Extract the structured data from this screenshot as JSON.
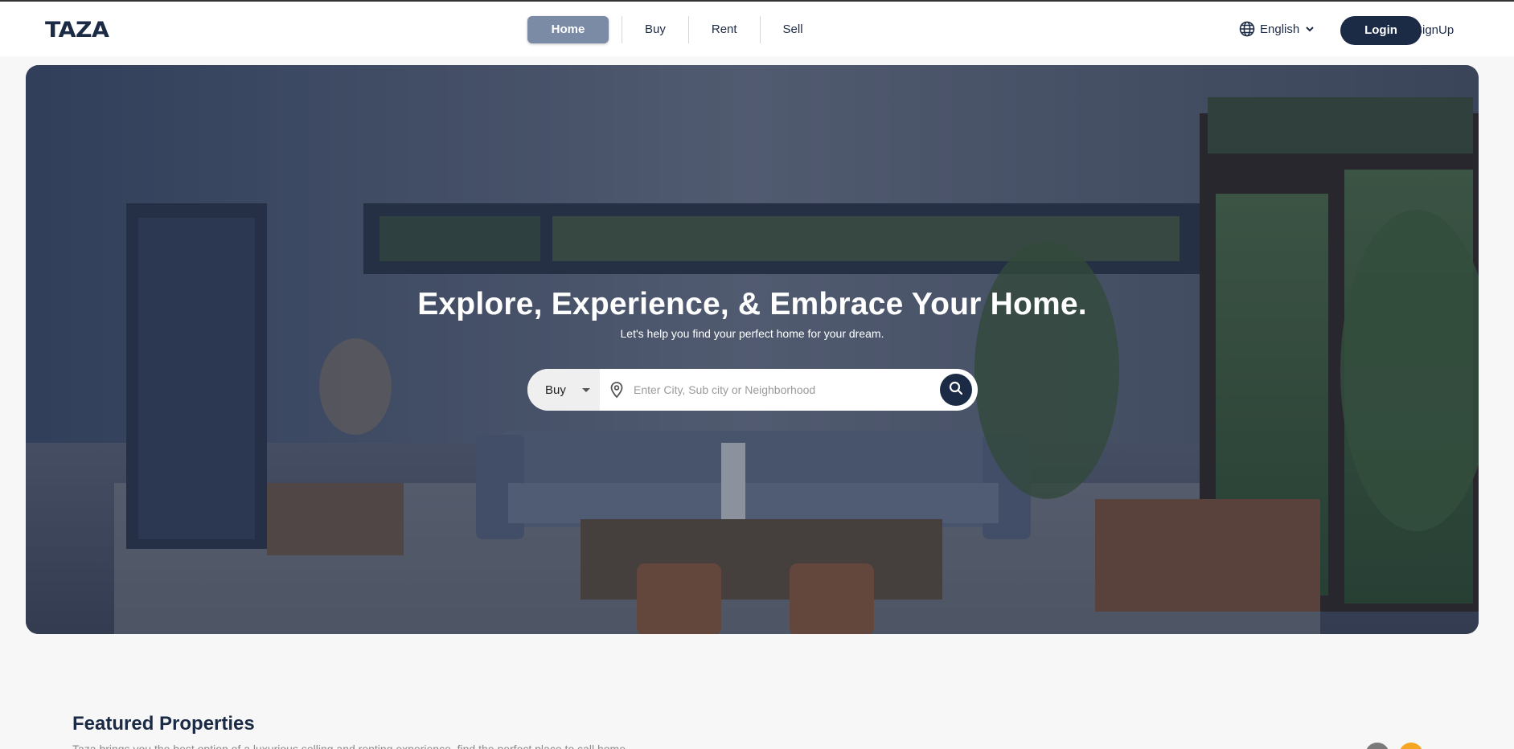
{
  "brand": {
    "logo_text": "TAZA"
  },
  "nav": {
    "links": [
      {
        "label": "Home",
        "active": true
      },
      {
        "label": "Buy",
        "active": false
      },
      {
        "label": "Rent",
        "active": false
      },
      {
        "label": "Sell",
        "active": false
      }
    ],
    "language": {
      "label": "English",
      "icon": "globe-icon"
    },
    "login_label": "Login",
    "signup_label": "SignUp"
  },
  "hero": {
    "title": "Explore, Experience, & Embrace Your Home.",
    "subtitle": "Let's help you find your perfect home for your dream.",
    "search": {
      "type_selected": "Buy",
      "placeholder": "Enter City, Sub city or Neighborhood",
      "value": ""
    }
  },
  "featured": {
    "title": "Featured Properties",
    "subtitle": "Taza brings you the best option of a luxurious selling and renting experience, find the perfect place to call home."
  },
  "colors": {
    "primary": "#1c2b45",
    "nav_active": "#7b8ba5",
    "accent": "#f5a623",
    "slider_grey": "#7a7a7a"
  }
}
